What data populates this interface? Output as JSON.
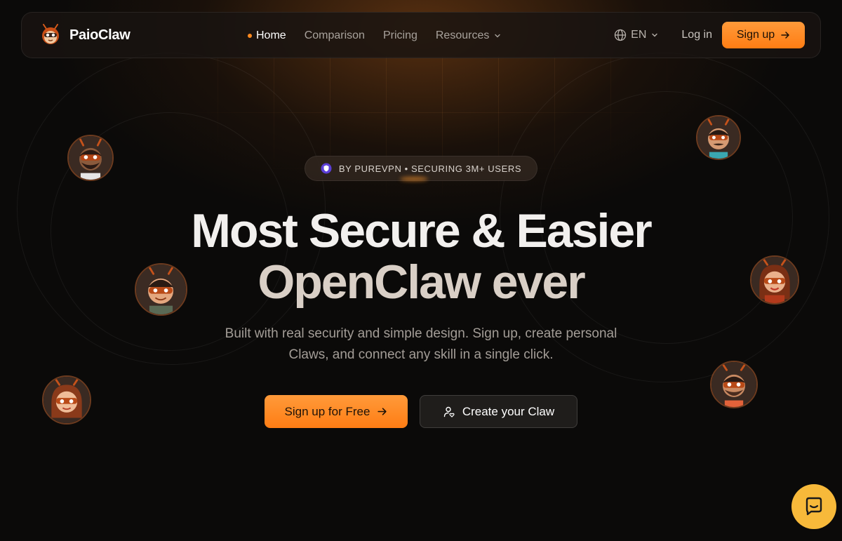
{
  "brand": {
    "name": "PaioClaw",
    "logo_icon": "claw-mascot-icon"
  },
  "nav": {
    "items": [
      {
        "label": "Home",
        "active": true
      },
      {
        "label": "Comparison",
        "active": false
      },
      {
        "label": "Pricing",
        "active": false
      },
      {
        "label": "Resources",
        "active": false,
        "has_dropdown": true
      }
    ],
    "language": "EN",
    "login_label": "Log in",
    "signup_label": "Sign up"
  },
  "hero": {
    "badge": "BY PUREVPN • SECURING 3M+ USERS",
    "title_line1": "Most Secure & Easier",
    "title_line2": "OpenClaw ever",
    "subtitle_line1": "Built with real security and simple design. Sign up, create personal",
    "subtitle_line2": "Claws, and connect any skill in a single click.",
    "cta_primary": "Sign up for Free",
    "cta_secondary": "Create your Claw"
  },
  "colors": {
    "accent": "#ff8a1f",
    "background": "#0b0a09",
    "chat": "#f7b93a"
  },
  "avatars": [
    {
      "name": "avatar-man-beard-dark"
    },
    {
      "name": "avatar-boy-glasses"
    },
    {
      "name": "avatar-woman-glasses-left"
    },
    {
      "name": "avatar-man-mustache-top-right"
    },
    {
      "name": "avatar-woman-glasses-right"
    },
    {
      "name": "avatar-man-beard-right"
    }
  ],
  "chat_widget": {
    "icon": "chat-bubble-icon"
  }
}
